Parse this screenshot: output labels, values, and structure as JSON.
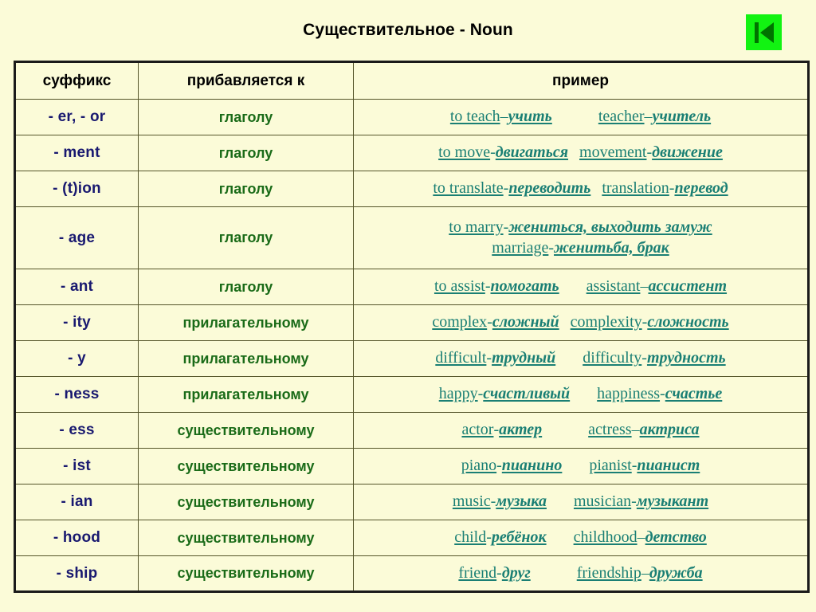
{
  "page": {
    "title": "Существительное - Noun",
    "background_color": "#fbfbd8",
    "nav_icon": "skip-to-start-icon",
    "nav_icon_color": "#12f312"
  },
  "table": {
    "headers": {
      "suffix": "суффикс",
      "attaches_to": "прибавляется к",
      "example": "пример"
    },
    "colors": {
      "suffix_text": "#191970",
      "attach_text": "#1a6b18",
      "example_text": "#1a7f74",
      "header_text": "#000000",
      "border": "#1a1a1a"
    },
    "rows": [
      {
        "suffix": "- er, - or",
        "attaches_to": "глаголу",
        "lines": [
          {
            "en1": "to teach",
            "dash1": "–",
            "ru1": "учить",
            "en2": "teacher",
            "dash2": "–",
            "ru2": "учитель",
            "gap": "gap-lg"
          }
        ]
      },
      {
        "suffix": "- ment",
        "attaches_to": "глаголу",
        "lines": [
          {
            "en1": "to move",
            "dash1": "-",
            "ru1": "двигаться",
            "en2": "movement",
            "dash2": "-",
            "ru2": "движение",
            "gap": "gap-sm"
          }
        ]
      },
      {
        "suffix": "- (t)ion",
        "attaches_to": "глаголу",
        "lines": [
          {
            "en1": "to translate",
            "dash1": "-",
            "ru1": "переводить",
            "en2": "translation",
            "dash2": "-",
            "ru2": "перевод",
            "gap": "gap-sm"
          }
        ]
      },
      {
        "suffix": "- age",
        "attaches_to": "глаголу",
        "tall": true,
        "lines": [
          {
            "en1": "to marry",
            "dash1": "-",
            "ru1": "жениться, выходить замуж",
            "en2": "",
            "dash2": "",
            "ru2": "",
            "gap": "gap-sm"
          },
          {
            "en1": "marriage",
            "dash1": "-",
            "ru1": "женитьба, брак",
            "en2": "",
            "dash2": "",
            "ru2": "",
            "gap": "gap-sm"
          }
        ]
      },
      {
        "suffix": "- ant",
        "attaches_to": "глаголу",
        "lines": [
          {
            "en1": "to assist",
            "dash1": "-",
            "ru1": "помогать",
            "en2": "assistant",
            "dash2": "–",
            "ru2": "ассистент",
            "gap": "gap-md"
          }
        ]
      },
      {
        "suffix": "- ity",
        "attaches_to": "прилагательному",
        "lines": [
          {
            "en1": "complex",
            "dash1": "-",
            "ru1": "сложный",
            "en2": "complexity",
            "dash2": "-",
            "ru2": "сложность",
            "gap": "gap-sm"
          }
        ]
      },
      {
        "suffix": "- y",
        "attaches_to": "прилагательному",
        "lines": [
          {
            "en1": "difficult",
            "dash1": "-",
            "ru1": "трудный",
            "en2": "difficulty",
            "dash2": "-",
            "ru2": "трудность",
            "gap": "gap-md"
          }
        ]
      },
      {
        "suffix": "- ness",
        "attaches_to": "прилагательному",
        "lines": [
          {
            "en1": "happy",
            "dash1": "-",
            "ru1": "счастливый",
            "en2": "happiness",
            "dash2": "-",
            "ru2": "счастье",
            "gap": "gap-md"
          }
        ]
      },
      {
        "suffix": "- ess",
        "attaches_to": "существительному",
        "lines": [
          {
            "en1": "actor",
            "dash1": "-",
            "ru1": "актер",
            "en2": "actress",
            "dash2": "–",
            "ru2": "актриса",
            "gap": "gap-lg"
          }
        ]
      },
      {
        "suffix": "- ist",
        "attaches_to": "существительному",
        "lines": [
          {
            "en1": "piano",
            "dash1": "-",
            "ru1": "пианино",
            "en2": "pianist",
            "dash2": "-",
            "ru2": "пианист",
            "gap": "gap-md"
          }
        ]
      },
      {
        "suffix": "- ian",
        "attaches_to": "существительному",
        "lines": [
          {
            "en1": "music",
            "dash1": "-",
            "ru1": "музыка",
            "en2": "musician",
            "dash2": "-",
            "ru2": "музыкант",
            "gap": "gap-md"
          }
        ]
      },
      {
        "suffix": "- hood",
        "attaches_to": "существительному",
        "lines": [
          {
            "en1": "child",
            "dash1": "-",
            "ru1": "ребёнок",
            "en2": "childhood",
            "dash2": "–",
            "ru2": "детство",
            "gap": "gap-md"
          }
        ]
      },
      {
        "suffix": "- ship",
        "attaches_to": "существительному",
        "lines": [
          {
            "en1": "friend",
            "dash1": "-",
            "ru1": "друг",
            "en2": "friendship",
            "dash2": "–",
            "ru2": "дружба",
            "gap": "gap-lg"
          }
        ]
      }
    ]
  }
}
